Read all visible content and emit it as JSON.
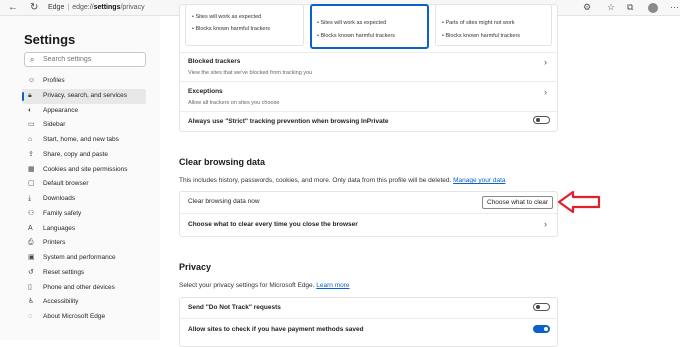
{
  "browser": {
    "brand": "Edge",
    "url_prefix": "edge://",
    "url_bold": "settings",
    "url_suffix": "/privacy"
  },
  "sidebar": {
    "title": "Settings",
    "search_placeholder": "Search settings",
    "items": [
      {
        "label": "Profiles",
        "icon": "profile-icon"
      },
      {
        "label": "Privacy, search, and services",
        "icon": "lock-icon"
      },
      {
        "label": "Appearance",
        "icon": "appearance-icon"
      },
      {
        "label": "Sidebar",
        "icon": "sidebar-icon"
      },
      {
        "label": "Start, home, and new tabs",
        "icon": "home-icon"
      },
      {
        "label": "Share, copy and paste",
        "icon": "share-icon"
      },
      {
        "label": "Cookies and site permissions",
        "icon": "cookie-icon"
      },
      {
        "label": "Default browser",
        "icon": "browser-icon"
      },
      {
        "label": "Downloads",
        "icon": "download-icon"
      },
      {
        "label": "Family safety",
        "icon": "family-icon"
      },
      {
        "label": "Languages",
        "icon": "language-icon"
      },
      {
        "label": "Printers",
        "icon": "printer-icon"
      },
      {
        "label": "System and performance",
        "icon": "system-icon"
      },
      {
        "label": "Reset settings",
        "icon": "reset-icon"
      },
      {
        "label": "Phone and other devices",
        "icon": "phone-icon"
      },
      {
        "label": "Accessibility",
        "icon": "accessibility-icon"
      },
      {
        "label": "About Microsoft Edge",
        "icon": "edge-icon"
      }
    ]
  },
  "tracking": {
    "cards": [
      {
        "line1": "Sites will work as expected",
        "line2": "Blocks known harmful trackers"
      },
      {
        "line1": "Sites will work as expected",
        "line2": "Blocks known harmful trackers"
      },
      {
        "line1": "Parts of sites might not work",
        "line2": "Blocks known harmful trackers"
      }
    ],
    "blocked_title": "Blocked trackers",
    "blocked_sub": "View the sites that we've blocked from tracking you",
    "exceptions_title": "Exceptions",
    "exceptions_sub": "Allow all trackers on sites you choose",
    "strict_label": "Always use \"Strict\" tracking prevention when browsing InPrivate",
    "strict_on": false
  },
  "clear": {
    "heading": "Clear browsing data",
    "description": "This includes history, passwords, cookies, and more. Only data from this profile will be deleted.",
    "manage_link": "Manage your data",
    "now_label": "Clear browsing data now",
    "button_label": "Choose what to clear",
    "on_close_label": "Choose what to clear every time you close the browser",
    "annotation_color": "#e0202a"
  },
  "privacy": {
    "heading": "Privacy",
    "description": "Select your privacy settings for Microsoft Edge.",
    "learn_link": "Learn more",
    "dnt_label": "Send \"Do Not Track\" requests",
    "dnt_on": false,
    "payment_label": "Allow sites to check if you have payment methods saved",
    "payment_on": true
  }
}
